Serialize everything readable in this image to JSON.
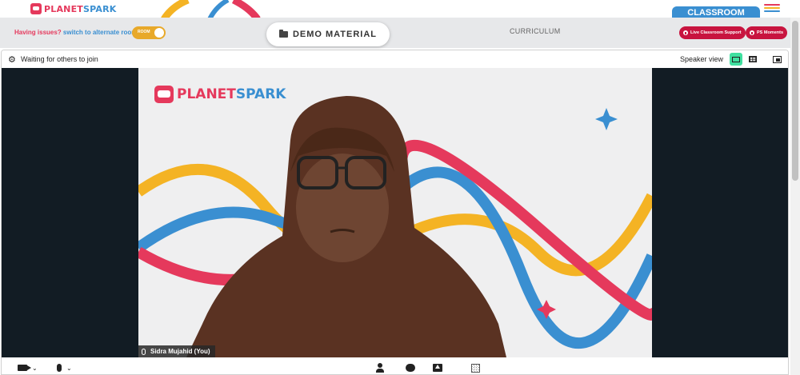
{
  "header": {
    "logo_text_1": "PLANET",
    "logo_text_2": "SPARK",
    "classroom_tab": "CLASSROOM"
  },
  "band": {
    "issues_text": "Having issues?",
    "switch_text": "switch to alternate room",
    "toggle_label": "ROOM",
    "demo_material": "DEMO MATERIAL",
    "curriculum": "CURRICULUM",
    "live_support": "Live Classroom Support",
    "ps_moments": "PS Moments"
  },
  "meeting": {
    "waiting_text": "Waiting for others to join",
    "speaker_view": "Speaker view",
    "participant_name": "Sidra Mujahid (You)",
    "video_logo_1": "PLANET",
    "video_logo_2": "SPARK"
  },
  "colors": {
    "brand_red": "#e5395c",
    "brand_blue": "#3a8fd1",
    "brand_yellow": "#f4b324",
    "pill_red": "#c8143f",
    "active_view": "#3fe0a0"
  },
  "icons": [
    "gear-icon",
    "folder-icon",
    "speaker-view-icon",
    "gallery-view-icon",
    "pip-icon",
    "video-camera-icon",
    "microphone-icon",
    "participants-icon",
    "chat-icon",
    "share-screen-icon",
    "record-icon"
  ]
}
